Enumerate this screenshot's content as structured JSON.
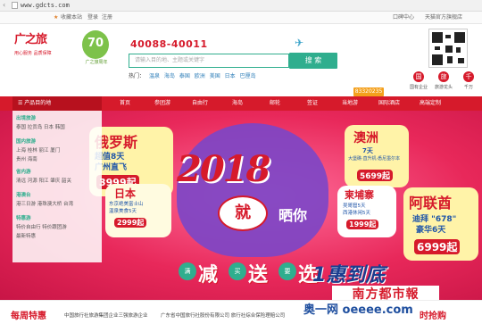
{
  "browser": {
    "url": "www.gdcts.com"
  },
  "topbar": {
    "favorite": "收藏本站",
    "login": "登录",
    "register": "注册",
    "user_center": "口碑中心",
    "store": "天猫官方旗舰店"
  },
  "header": {
    "logo_text": "广之旅",
    "logo_tagline": "用心服务 品质保障",
    "anniversary": "70",
    "anniversary_sub": "广之旅周年",
    "hotline": "40088-40011",
    "search_placeholder": "请输入目的地、主题或关键字",
    "search_button": "搜 索",
    "hot_label": "热门：",
    "hot_links": [
      "温泉",
      "海岛",
      "泰国",
      "欧洲",
      "美国",
      "日本",
      "巴厘岛"
    ],
    "side_links": [
      {
        "icon": "国",
        "label": "国有企业"
      },
      {
        "icon": "旅",
        "label": "旅游龙头"
      },
      {
        "icon": "千",
        "label": "千万"
      }
    ]
  },
  "nav": {
    "category_label": "产品目的地",
    "badge": "83320235",
    "items": [
      "首页",
      "参团游",
      "自由行",
      "海岛",
      "邮轮",
      "签证",
      "当地游",
      "国际酒店",
      "高端定制"
    ]
  },
  "category_menu": [
    {
      "head": "出境旅游",
      "rows": [
        "泰国  拉贡岛  日本  韩国"
      ]
    },
    {
      "head": "国内旅游",
      "rows": [
        "上海  桂林  丽江  厦门",
        "贵州  海南"
      ]
    },
    {
      "head": "省内游",
      "rows": [
        "清远  河源  阳江  肇庆  韶关"
      ]
    },
    {
      "head": "港澳台",
      "rows": [
        "港三日游  港珠澳大桥  台湾"
      ]
    },
    {
      "head": "特惠游",
      "rows": [
        "特价自由行  特价跟团游",
        "最新特惠"
      ]
    }
  ],
  "banner": {
    "year": "2018",
    "jiu": "就",
    "shai": "晒你",
    "promos": [
      {
        "title": "俄罗斯",
        "line1": "超值8天",
        "line2": "广州直飞",
        "price": "3999起"
      },
      {
        "title": "日本",
        "line1": "东京绝美富士山",
        "line2": "温泉美食5天",
        "price": "2999起"
      },
      {
        "title": "澳洲",
        "line1": "7天",
        "line2": "大堡礁·直升机·悉尼墨尔本",
        "price": "5699起"
      },
      {
        "title": "柬埔寨",
        "line1": "吴哥窟5天",
        "line2": "西港休闲5天",
        "price": "1999起"
      },
      {
        "title": "阿联酋",
        "line1": "迪拜 \"678\"",
        "line2": "豪华6天",
        "price": "6999起"
      }
    ],
    "slogan": {
      "chips": [
        "满",
        "买",
        "要"
      ],
      "words": [
        "减",
        "送",
        "选"
      ],
      "hui": "1惠到底"
    },
    "paper": "南方都市報"
  },
  "footer": {
    "title": "每周特惠",
    "items": [
      "中国旅行社旅游集团企业三强旅游企业",
      "广东省中国旅行社股份有限公司 旅行社综合保险理赔公司"
    ],
    "right": "时抢购"
  },
  "watermark": "奥一网 oeeee.com"
}
